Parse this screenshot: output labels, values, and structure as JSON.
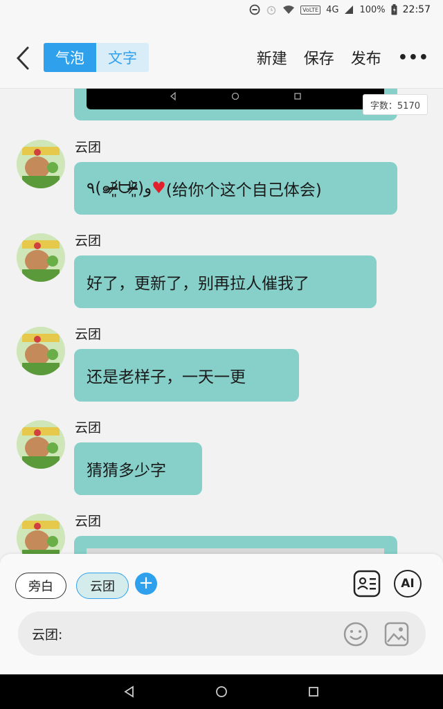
{
  "statusbar": {
    "network": "4G",
    "volte": "VoLTE",
    "battery": "100%",
    "time": "22:57"
  },
  "header": {
    "tabs": [
      "气泡",
      "文字"
    ],
    "actions": {
      "new": "新建",
      "save": "保存",
      "publish": "发布",
      "more": "•••"
    }
  },
  "chat": {
    "word_count": "字数：5170",
    "messages": [
      {
        "sender": "云团",
        "text_a": "٩(๑ᵒ̴̶̷͈᷄ᗨᵒ̴̶̷͈᷅)و",
        "heart": "♥",
        "text_b": "(给你个这个自己体会)"
      },
      {
        "sender": "云团",
        "text": "好了，更新了，别再拉人催我了"
      },
      {
        "sender": "云团",
        "text": "还是老样子，一天一更"
      },
      {
        "sender": "云团",
        "text": "猜猜多少字"
      },
      {
        "sender": "云团"
      }
    ]
  },
  "panel": {
    "roles": [
      "旁白",
      "云团"
    ],
    "add": "+",
    "ai": "AI",
    "input_value": "云团:"
  },
  "colors": {
    "accent": "#2ea0ec",
    "bubble": "#86d0c9"
  }
}
